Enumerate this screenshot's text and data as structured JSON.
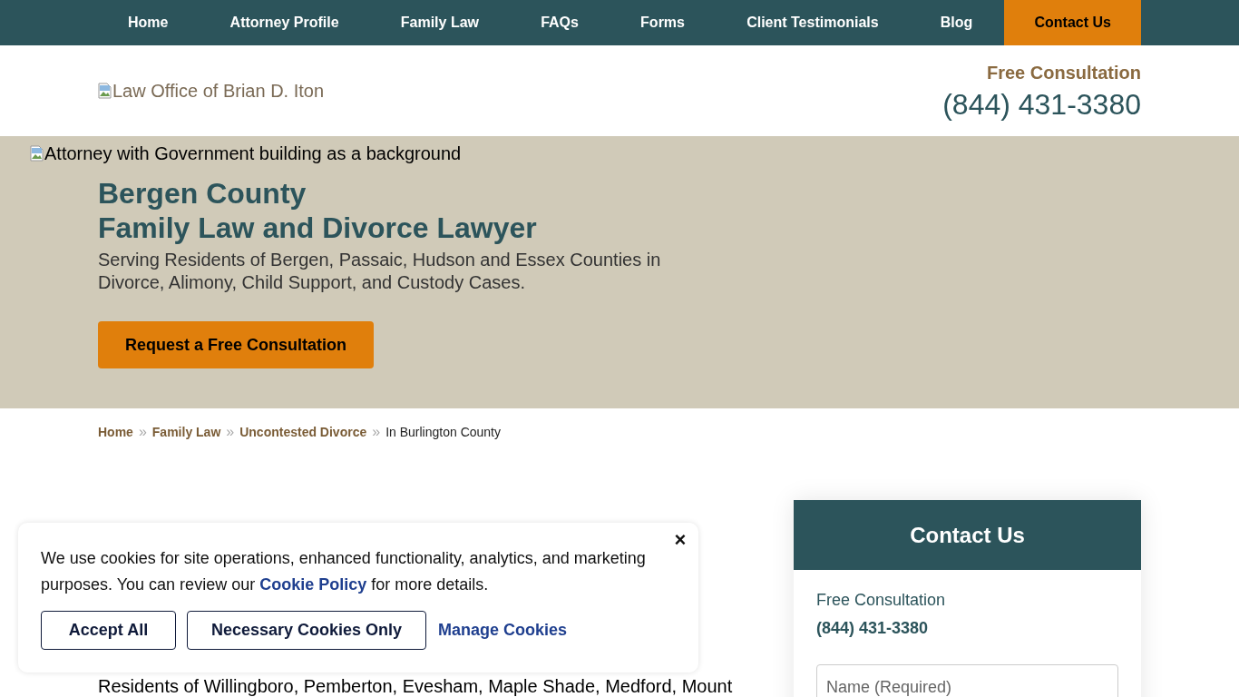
{
  "nav": {
    "items": [
      {
        "label": "Home",
        "kind": "link"
      },
      {
        "label": "Attorney Profile",
        "kind": "link"
      },
      {
        "label": "Family Law",
        "kind": "link"
      },
      {
        "label": "FAQs",
        "kind": "link"
      },
      {
        "label": "Forms",
        "kind": "link"
      },
      {
        "label": "Client Testimonials",
        "kind": "link"
      },
      {
        "label": "Blog",
        "kind": "link"
      },
      {
        "label": "Contact Us",
        "kind": "cta"
      }
    ]
  },
  "header": {
    "logo_alt": "Law Office of Brian D. Iton",
    "consultation_label": "Free Consultation",
    "phone": "(844) 431-3380"
  },
  "hero": {
    "image_alt": "Attorney with Government building as a background",
    "title_lines": [
      "Bergen County",
      "Family Law and Divorce Lawyer"
    ],
    "subtitle": "Serving Residents of Bergen, Passaic, Hudson and Essex Counties in Divorce, Alimony, Child Support, and Custody Cases.",
    "button": "Request a Free Consultation"
  },
  "breadcrumb": [
    {
      "label": "Home",
      "kind": "link"
    },
    {
      "label": "Family Law",
      "kind": "link"
    },
    {
      "label": "Uncontested Divorce",
      "kind": "link"
    },
    {
      "label": "In Burlington County",
      "kind": "current"
    }
  ],
  "breadcrumb_separator": "»",
  "content": {
    "paragraph": "Residents of Willingboro, Pemberton, Evesham, Maple Shade, Medford, Mount"
  },
  "sidebar": {
    "title": "Contact Us",
    "consultation_label": "Free Consultation",
    "phone": "(844) 431-3380",
    "fields": [
      {
        "placeholder": "Name (Required)"
      }
    ]
  },
  "cookie_banner": {
    "close": "×",
    "text_before": "We use cookies for site operations, enhanced functionality, analytics, and marketing purposes. You can review our ",
    "link": "Cookie Policy",
    "text_after": " for more details.",
    "buttons": [
      "Accept All",
      "Necessary Cookies Only"
    ],
    "manage_link": "Manage Cookies"
  }
}
